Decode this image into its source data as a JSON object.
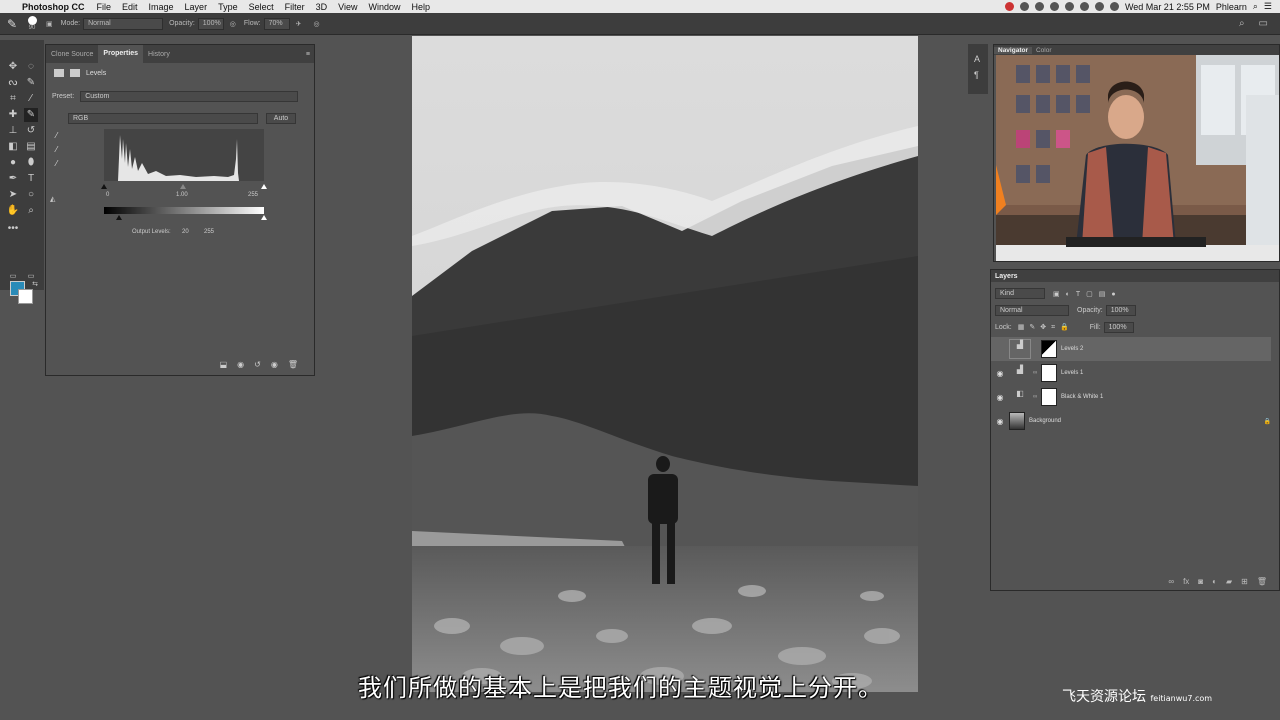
{
  "menubar": {
    "app": "Photoshop CC",
    "items": [
      "File",
      "Edit",
      "Image",
      "Layer",
      "Type",
      "Select",
      "Filter",
      "3D",
      "View",
      "Window",
      "Help"
    ],
    "clock": "Wed Mar 21  2:55 PM",
    "user": "Phlearn"
  },
  "options": {
    "brush_size": "90",
    "mode_label": "Mode:",
    "mode_value": "Normal",
    "opacity_label": "Opacity:",
    "opacity_value": "100%",
    "flow_label": "Flow:",
    "flow_value": "70%"
  },
  "properties": {
    "tabs": [
      "Clone Source",
      "Properties",
      "History"
    ],
    "active_tab": "Properties",
    "title": "Levels",
    "preset_label": "Preset:",
    "preset_value": "Custom",
    "channel": "RGB",
    "auto_label": "Auto",
    "input_black": "0",
    "input_gamma": "1.00",
    "input_white": "255",
    "output_label": "Output Levels:",
    "output_black": "20",
    "output_white": "255"
  },
  "navigator": {
    "tabs": [
      "Navigator",
      "Color"
    ]
  },
  "layers": {
    "title": "Layers",
    "kind_label": "Kind",
    "blend_mode": "Normal",
    "opacity_label": "Opacity:",
    "opacity_value": "100%",
    "lock_label": "Lock:",
    "fill_label": "Fill:",
    "fill_value": "100%",
    "items": [
      {
        "name": "Levels 2"
      },
      {
        "name": "Levels 1"
      },
      {
        "name": "Black & White 1"
      },
      {
        "name": "Background"
      }
    ]
  },
  "subtitle": "我们所做的基本上是把我们的主题视觉上分开。",
  "watermark": {
    "cn": "飞天资源论坛",
    "url": "feitianwu7.com"
  }
}
